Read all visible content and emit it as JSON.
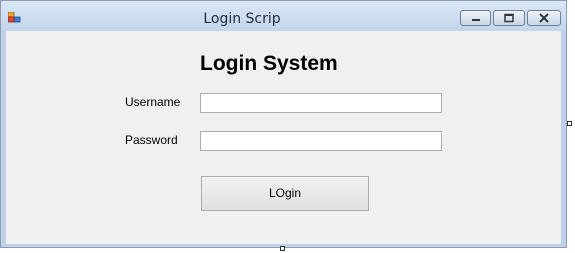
{
  "window": {
    "title": "Login Scrip",
    "controls": [
      "minimize-icon",
      "maximize-icon",
      "close-icon"
    ]
  },
  "form": {
    "heading": "Login System",
    "username": {
      "label": "Username",
      "value": "",
      "placeholder": ""
    },
    "password": {
      "label": "Password",
      "value": "",
      "placeholder": ""
    },
    "login_button_label": "LOgin"
  },
  "colors": {
    "titlebar": "#c2d5ec",
    "client_background": "#f0f0f0",
    "field_border": "#abadb3"
  }
}
